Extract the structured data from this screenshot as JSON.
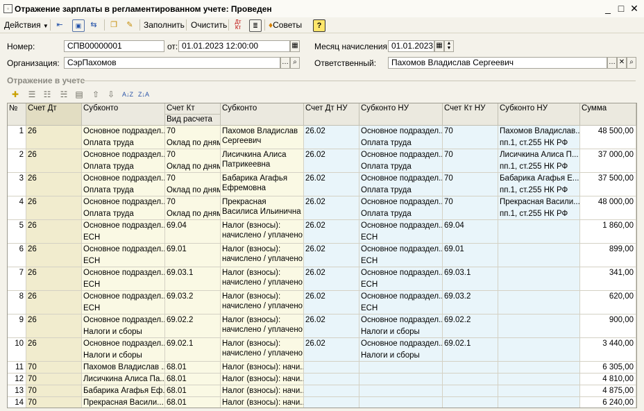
{
  "window": {
    "title": "Отражение зарплаты в регламентированном учете: Проведен",
    "controls": [
      "_",
      "□",
      "✕"
    ]
  },
  "toolbar": {
    "actions_label": "Действия",
    "fill_label": "Заполнить",
    "clear_label": "Очистить",
    "tips_label": "Советы",
    "help_label": "?"
  },
  "form": {
    "number_label": "Номер:",
    "number_value": "СПВ00000001",
    "from_label": "от:",
    "date_value": "01.01.2023 12:00:00",
    "month_label": "Месяц начисления:",
    "month_value": "01.01.2023",
    "org_label": "Организация:",
    "org_value": "СэрПахомов",
    "resp_label": "Ответственный:",
    "resp_value": "Пахомов Владислав Сергеевич"
  },
  "section_title": "Отражение в учете",
  "table": {
    "headers": {
      "n": "№",
      "dt": "Счет Дт",
      "sub1": "Субконто",
      "kt": "Счет Кт",
      "kt2": "Вид расчета",
      "sub2": "Субконто",
      "dtnu": "Счет Дт НУ",
      "subnu1": "Субконто НУ",
      "ktnu": "Счет Кт НУ",
      "subnu2": "Субконто НУ",
      "sum": "Сумма"
    },
    "rows": [
      {
        "n": "1",
        "dt": "26",
        "s1a": "Основное подраздел...",
        "s1b": "Оплата труда",
        "kt": "70",
        "kt2": "Оклад по дням",
        "s2": "Пахомов Владислав Сергеевич",
        "dtnu": "26.02",
        "snu1a": "Основное подраздел...",
        "snu1b": "Оплата труда",
        "ktnu": "70",
        "snu2a": "Пахомов Владислав...",
        "snu2b": "пп.1, ст.255 НК РФ",
        "sum": "48 500,00"
      },
      {
        "n": "2",
        "dt": "26",
        "s1a": "Основное подраздел...",
        "s1b": "Оплата труда",
        "kt": "70",
        "kt2": "Оклад по дням",
        "s2": "Лисичкина Алиса Патрикеевна",
        "dtnu": "26.02",
        "snu1a": "Основное подраздел...",
        "snu1b": "Оплата труда",
        "ktnu": "70",
        "snu2a": "Лисичкина Алиса П...",
        "snu2b": "пп.1, ст.255 НК РФ",
        "sum": "37 000,00"
      },
      {
        "n": "3",
        "dt": "26",
        "s1a": "Основное подраздел...",
        "s1b": "Оплата труда",
        "kt": "70",
        "kt2": "Оклад по дням",
        "s2": "Бабарика Агафья Ефремовна",
        "dtnu": "26.02",
        "snu1a": "Основное подраздел...",
        "snu1b": "Оплата труда",
        "ktnu": "70",
        "snu2a": "Бабарика Агафья Е...",
        "snu2b": "пп.1, ст.255 НК РФ",
        "sum": "37 500,00"
      },
      {
        "n": "4",
        "dt": "26",
        "s1a": "Основное подраздел...",
        "s1b": "Оплата труда",
        "kt": "70",
        "kt2": "Оклад по дням",
        "s2": "Прекрасная Василиса Ильинична",
        "dtnu": "26.02",
        "snu1a": "Основное подраздел...",
        "snu1b": "Оплата труда",
        "ktnu": "70",
        "snu2a": "Прекрасная Васили...",
        "snu2b": "пп.1, ст.255 НК РФ",
        "sum": "48 000,00"
      },
      {
        "n": "5",
        "dt": "26",
        "s1a": "Основное подраздел...",
        "s1b": "ЕСН",
        "kt": "69.04",
        "kt2": "",
        "s2": "Налог (взносы): начислено / уплачено",
        "dtnu": "26.02",
        "snu1a": "Основное подраздел...",
        "snu1b": "ЕСН",
        "ktnu": "69.04",
        "snu2a": "",
        "snu2b": "",
        "sum": "1 860,00"
      },
      {
        "n": "6",
        "dt": "26",
        "s1a": "Основное подраздел...",
        "s1b": "ЕСН",
        "kt": "69.01",
        "kt2": "",
        "s2": "Налог (взносы): начислено / уплачено",
        "dtnu": "26.02",
        "snu1a": "Основное подраздел...",
        "snu1b": "ЕСН",
        "ktnu": "69.01",
        "snu2a": "",
        "snu2b": "",
        "sum": "899,00"
      },
      {
        "n": "7",
        "dt": "26",
        "s1a": "Основное подраздел...",
        "s1b": "ЕСН",
        "kt": "69.03.1",
        "kt2": "",
        "s2": "Налог (взносы): начислено / уплачено",
        "dtnu": "26.02",
        "snu1a": "Основное подраздел...",
        "snu1b": "ЕСН",
        "ktnu": "69.03.1",
        "snu2a": "",
        "snu2b": "",
        "sum": "341,00"
      },
      {
        "n": "8",
        "dt": "26",
        "s1a": "Основное подраздел...",
        "s1b": "ЕСН",
        "kt": "69.03.2",
        "kt2": "",
        "s2": "Налог (взносы): начислено / уплачено",
        "dtnu": "26.02",
        "snu1a": "Основное подраздел...",
        "snu1b": "ЕСН",
        "ktnu": "69.03.2",
        "snu2a": "",
        "snu2b": "",
        "sum": "620,00"
      },
      {
        "n": "9",
        "dt": "26",
        "s1a": "Основное подраздел...",
        "s1b": "Налоги и сборы",
        "kt": "69.02.2",
        "kt2": "",
        "s2": "Налог (взносы): начислено / уплачено",
        "dtnu": "26.02",
        "snu1a": "Основное подраздел...",
        "snu1b": "Налоги и сборы",
        "ktnu": "69.02.2",
        "snu2a": "",
        "snu2b": "",
        "sum": "900,00"
      },
      {
        "n": "10",
        "dt": "26",
        "s1a": "Основное подраздел...",
        "s1b": "Налоги и сборы",
        "kt": "69.02.1",
        "kt2": "",
        "s2": "Налог (взносы): начислено / уплачено",
        "dtnu": "26.02",
        "snu1a": "Основное подраздел...",
        "snu1b": "Налоги и сборы",
        "ktnu": "69.02.1",
        "snu2a": "",
        "snu2b": "",
        "sum": "3 440,00"
      }
    ],
    "short_rows": [
      {
        "n": "11",
        "dt": "70",
        "s1": "Пахомов Владислав ...",
        "kt": "68.01",
        "s2": "Налог (взносы): начи...",
        "sum": "6 305,00"
      },
      {
        "n": "12",
        "dt": "70",
        "s1": "Лисичкина Алиса Па...",
        "kt": "68.01",
        "s2": "Налог (взносы): начи...",
        "sum": "4 810,00"
      },
      {
        "n": "13",
        "dt": "70",
        "s1": "Бабарика Агафья Еф...",
        "kt": "68.01",
        "s2": "Налог (взносы): начи...",
        "sum": "4 875,00"
      },
      {
        "n": "14",
        "dt": "70",
        "s1": "Прекрасная Васили...",
        "kt": "68.01",
        "s2": "Налог (взносы): начи...",
        "sum": "6 240,00"
      }
    ]
  }
}
